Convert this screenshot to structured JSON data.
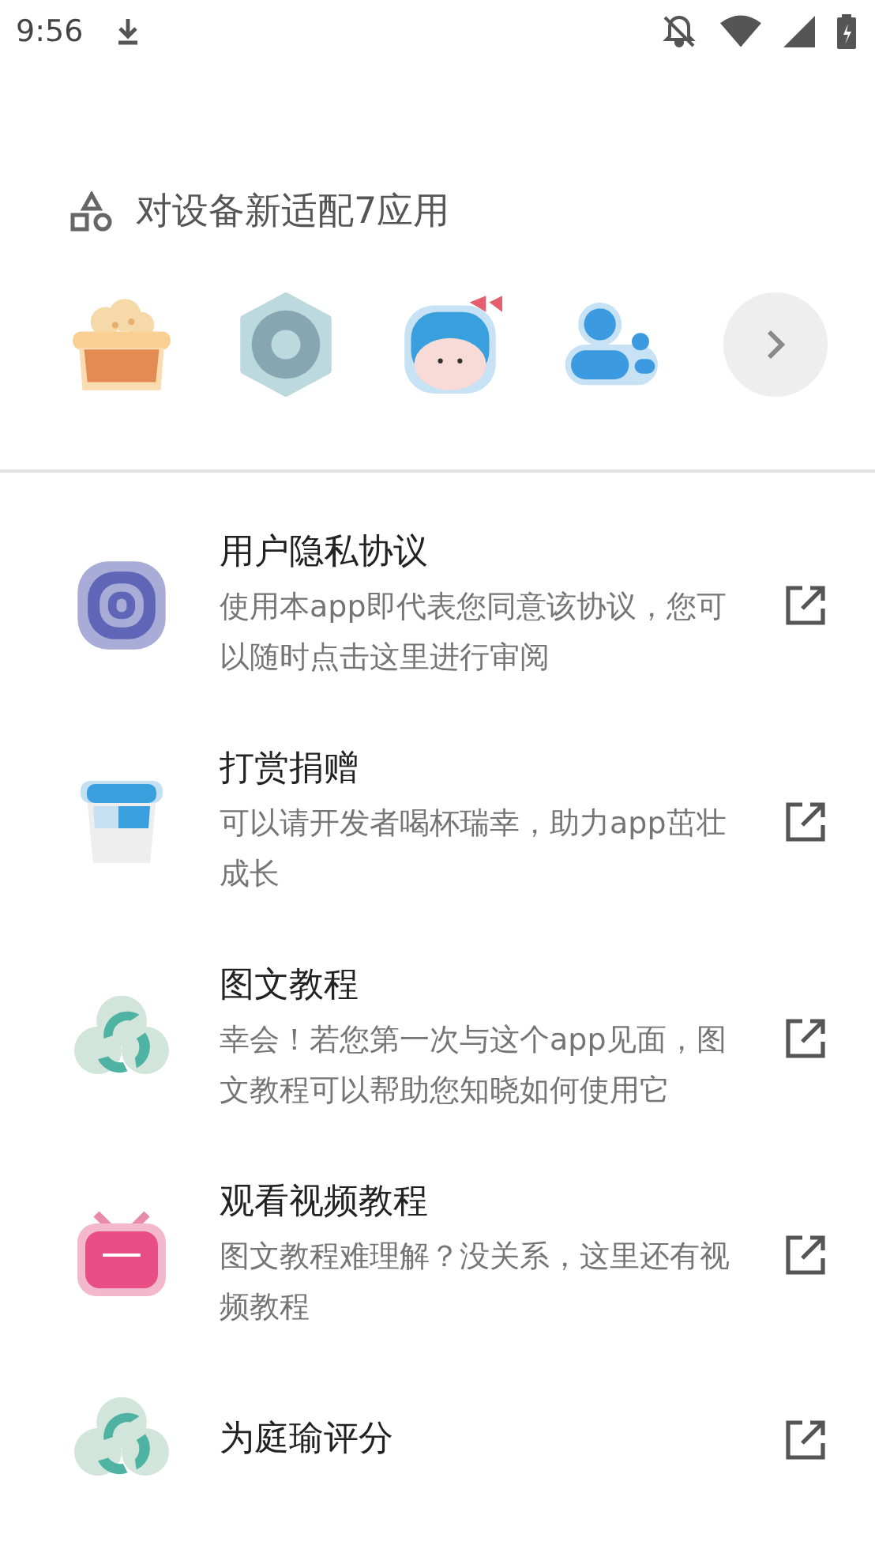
{
  "status_bar": {
    "time": "9:56"
  },
  "adapted_apps": {
    "title": "对设备新适配7应用",
    "apps": [
      {
        "kind": "popcorn"
      },
      {
        "kind": "flower"
      },
      {
        "kind": "girl"
      },
      {
        "kind": "contacts"
      }
    ]
  },
  "items": [
    {
      "kind": "privacy",
      "title": "用户隐私协议",
      "description": "使用本app即代表您同意该协议，您可以随时点击这里进行审阅"
    },
    {
      "kind": "cup",
      "title": "打赏捐赠",
      "description": "可以请开发者喝杯瑞幸，助力app茁壮成长"
    },
    {
      "kind": "swirl",
      "title": "图文教程",
      "description": "幸会！若您第一次与这个app见面，图文教程可以帮助您知晓如何使用它"
    },
    {
      "kind": "tv",
      "title": "观看视频教程",
      "description": "图文教程难理解？没关系，这里还有视频教程"
    },
    {
      "kind": "swirl",
      "title": "为庭瑜评分"
    }
  ]
}
